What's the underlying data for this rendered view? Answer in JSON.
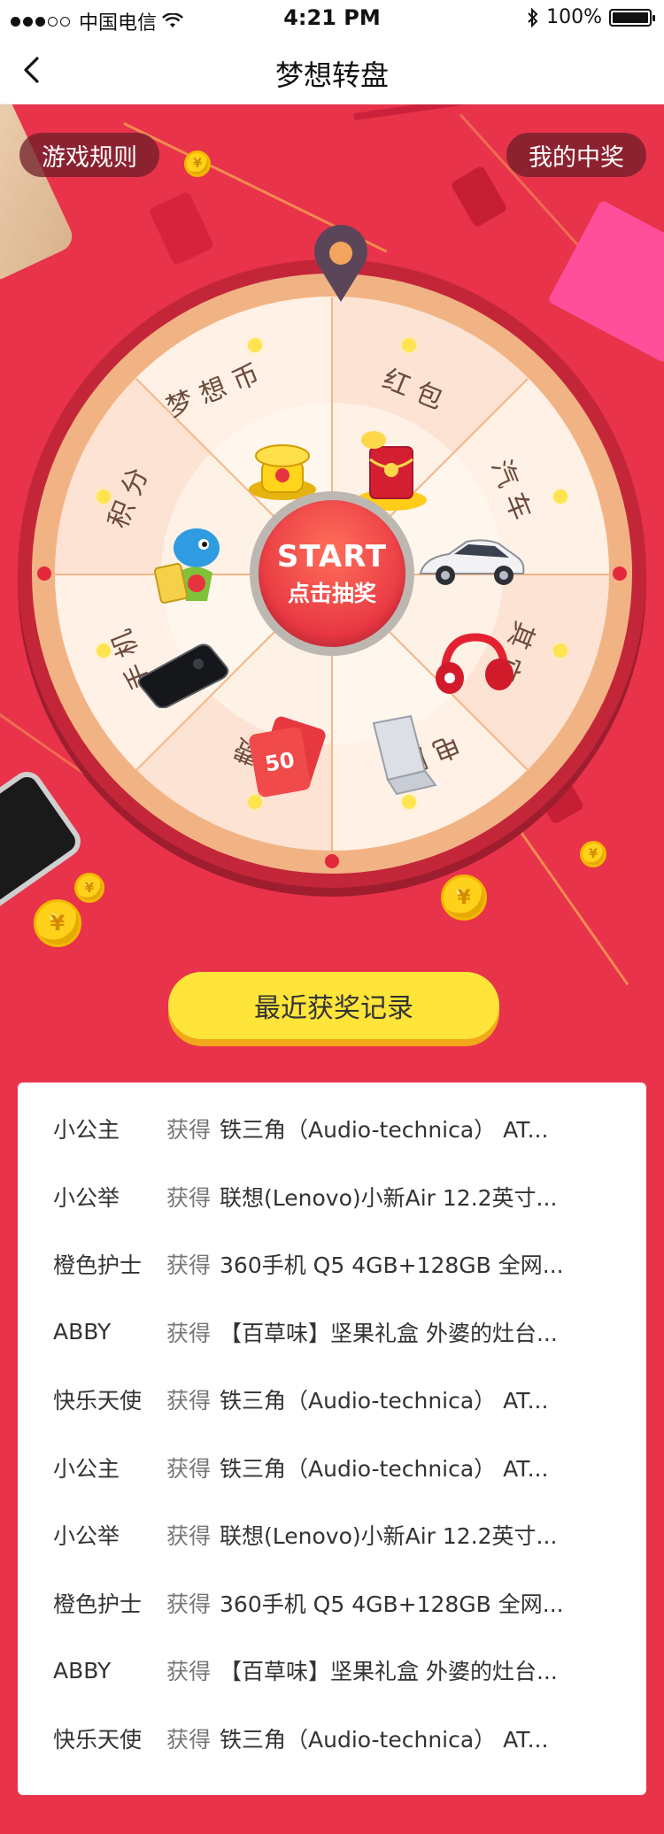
{
  "status_bar": {
    "carrier": "中国电信",
    "time": "4:21 PM",
    "battery": "100%",
    "battery_level": 1.0
  },
  "nav": {
    "title": "梦想转盘"
  },
  "buttons": {
    "rules": "游戏规则",
    "my_prizes": "我的中奖"
  },
  "wheel": {
    "sectors": [
      {
        "label": "梦想币",
        "prize": "gold-coins"
      },
      {
        "label": "红包",
        "prize": "red-envelope"
      },
      {
        "label": "汽车",
        "prize": "car"
      },
      {
        "label": "其它",
        "prize": "headphones"
      },
      {
        "label": "电脑",
        "prize": "laptop"
      },
      {
        "label": "话费",
        "prize": "phone-credit-card"
      },
      {
        "label": "手机",
        "prize": "smartphone"
      },
      {
        "label": "积分",
        "prize": "points-mascot"
      }
    ],
    "start_en": "START",
    "start_cn": "点击抽奖",
    "card_text": "50",
    "accent": "#e8334a"
  },
  "records": {
    "title": "最近获奖记录",
    "verb": "获得",
    "rows": [
      {
        "user": "小公主",
        "item": "铁三角（Audio-technica） AT..."
      },
      {
        "user": "小公举",
        "item": "联想(Lenovo)小新Air 12.2英寸..."
      },
      {
        "user": "橙色护士",
        "item": "360手机 Q5 4GB+128GB 全网..."
      },
      {
        "user": "ABBY",
        "item": "【百草味】坚果礼盒 外婆的灶台..."
      },
      {
        "user": "快乐天使",
        "item": "铁三角（Audio-technica） AT..."
      },
      {
        "user": "小公主",
        "item": "铁三角（Audio-technica） AT..."
      },
      {
        "user": "小公举",
        "item": "联想(Lenovo)小新Air 12.2英寸..."
      },
      {
        "user": "橙色护士",
        "item": "360手机 Q5 4GB+128GB 全网..."
      },
      {
        "user": "ABBY",
        "item": "【百草味】坚果礼盒 外婆的灶台..."
      },
      {
        "user": "快乐天使",
        "item": "铁三角（Audio-technica） AT..."
      }
    ]
  }
}
